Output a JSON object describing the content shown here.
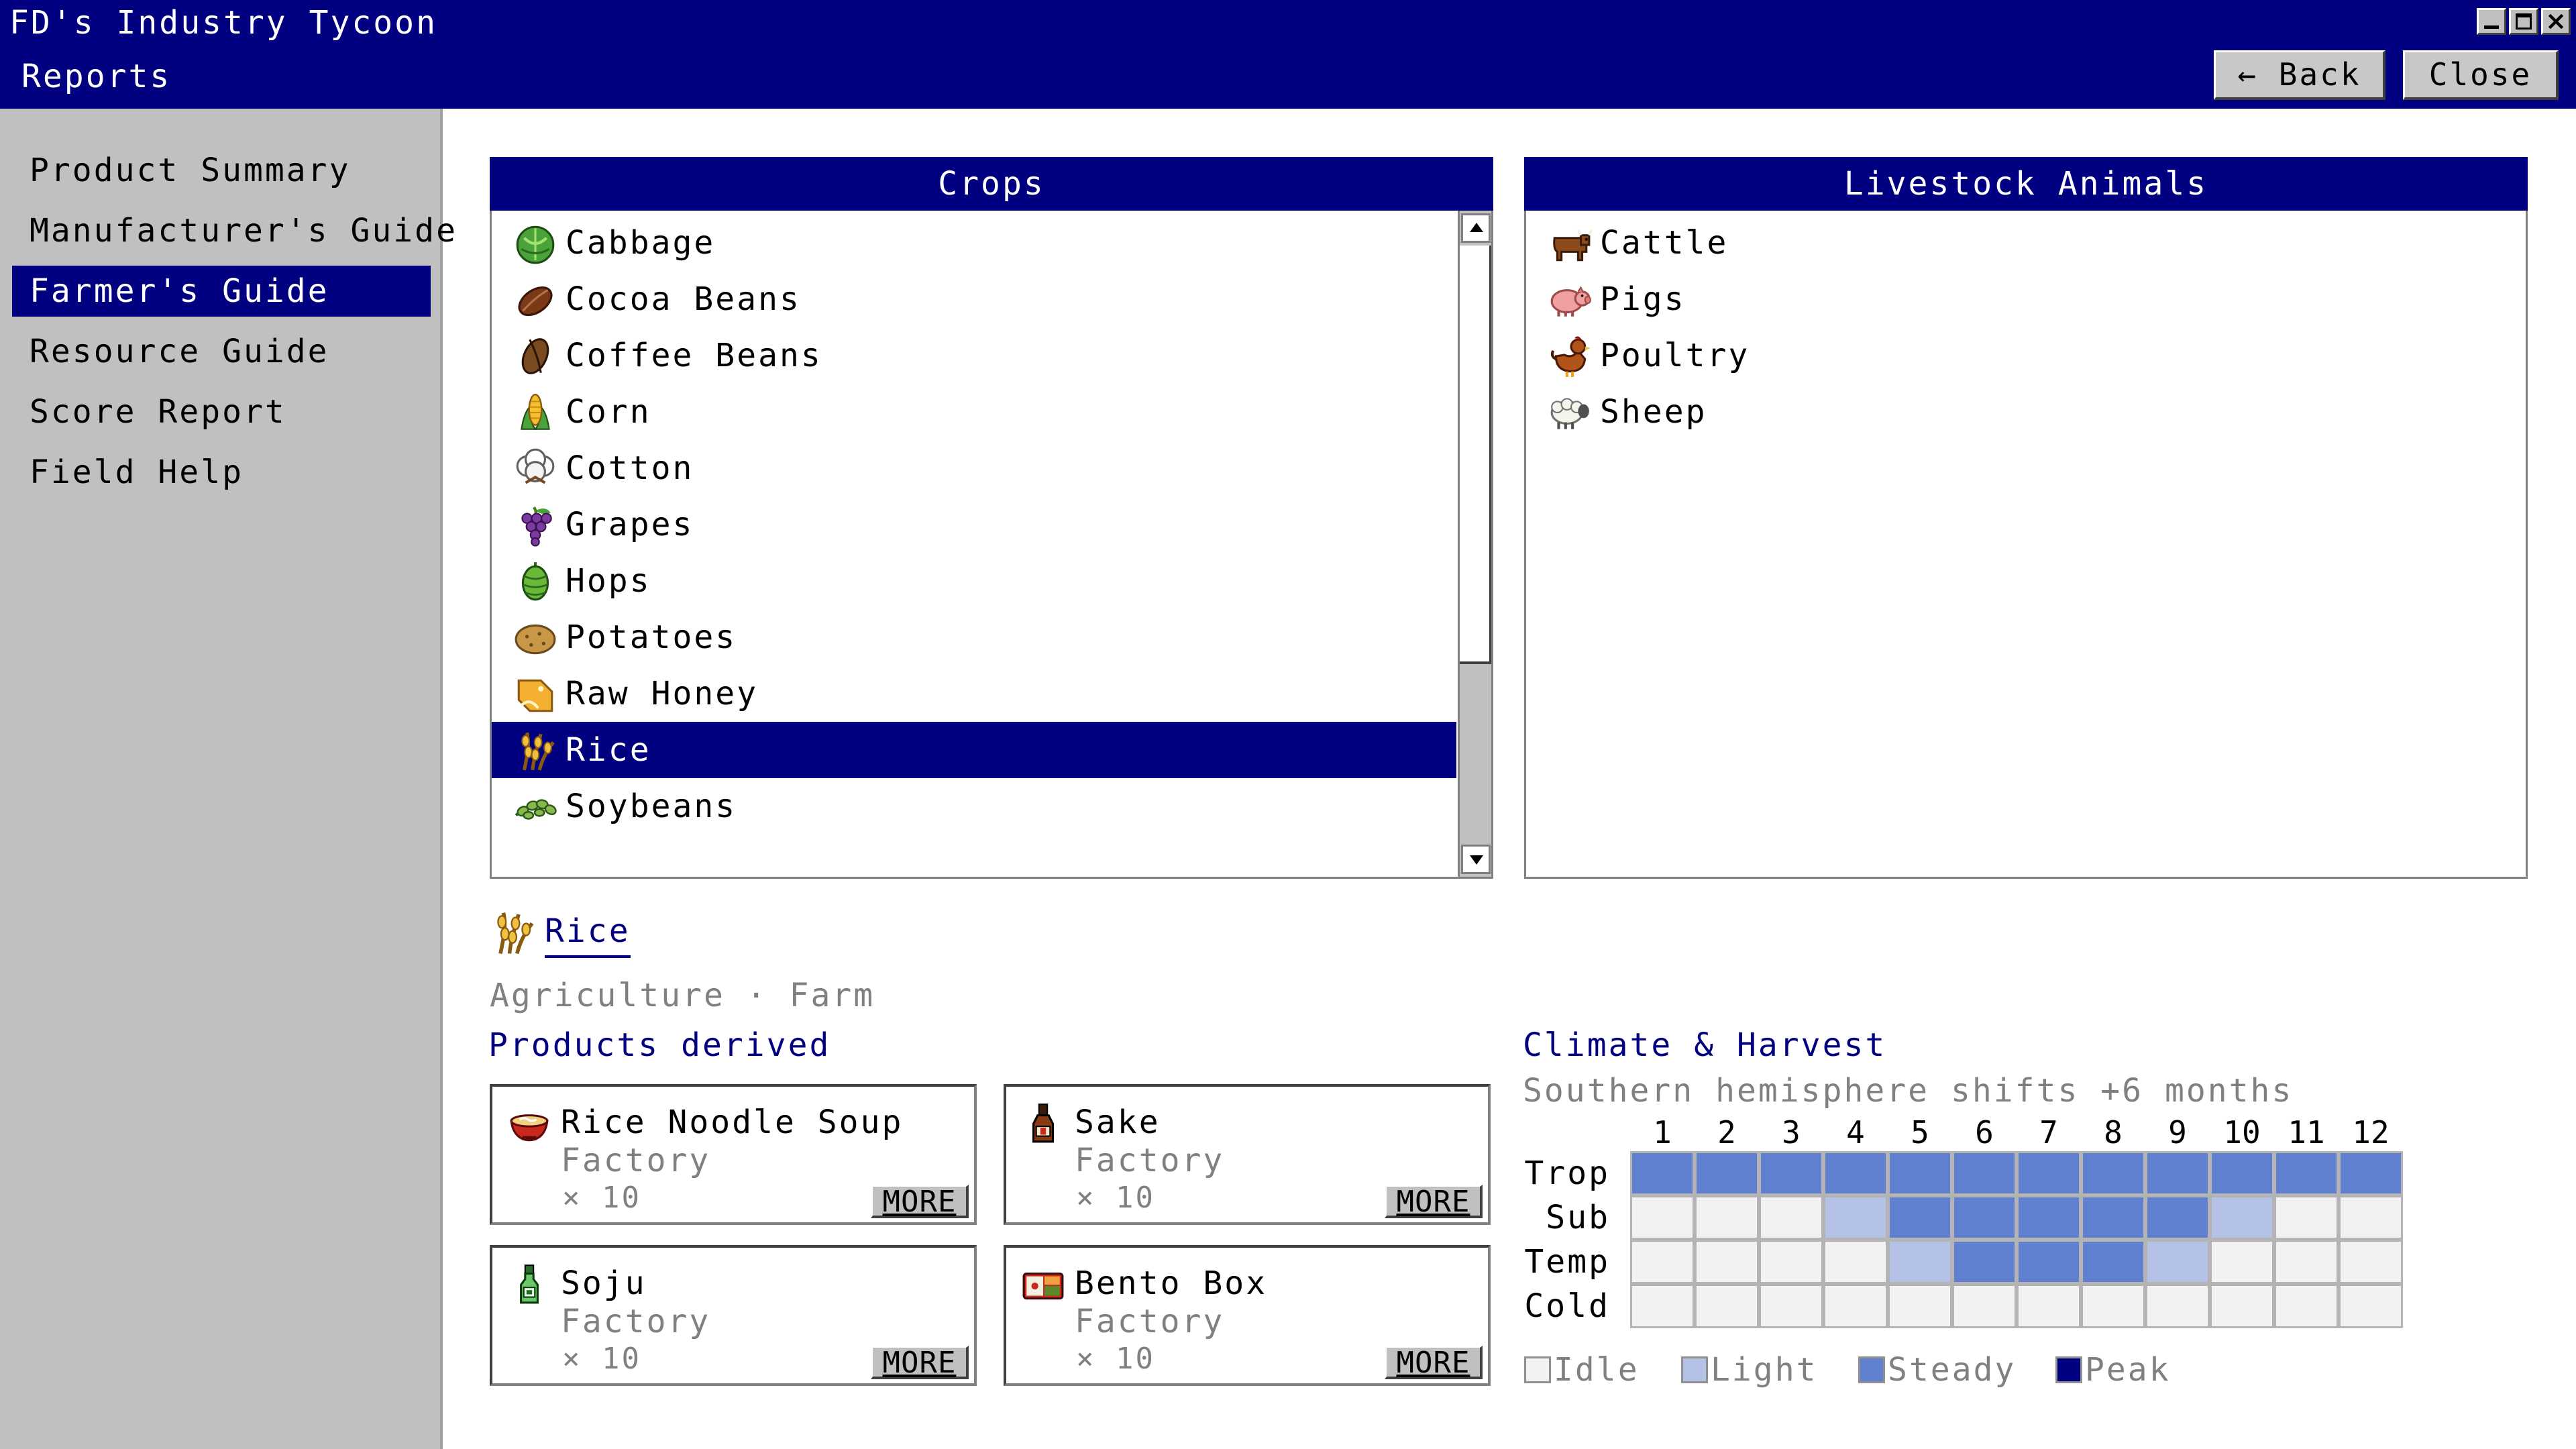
{
  "window": {
    "title": "FD's Industry Tycoon",
    "subtitle": "Reports",
    "back_label": "← Back",
    "close_label": "Close"
  },
  "sidebar": {
    "items": [
      {
        "label": "Product Summary",
        "active": false
      },
      {
        "label": "Manufacturer's Guide",
        "active": false
      },
      {
        "label": "Farmer's Guide",
        "active": true
      },
      {
        "label": "Resource Guide",
        "active": false
      },
      {
        "label": "Score Report",
        "active": false
      },
      {
        "label": "Field Help",
        "active": false
      }
    ]
  },
  "crops": {
    "title": "Crops",
    "selected": "Rice",
    "items": [
      {
        "label": "Cabbage",
        "icon": "cabbage-icon"
      },
      {
        "label": "Cocoa Beans",
        "icon": "cocoa-beans-icon"
      },
      {
        "label": "Coffee Beans",
        "icon": "coffee-beans-icon"
      },
      {
        "label": "Corn",
        "icon": "corn-icon"
      },
      {
        "label": "Cotton",
        "icon": "cotton-icon"
      },
      {
        "label": "Grapes",
        "icon": "grapes-icon"
      },
      {
        "label": "Hops",
        "icon": "hops-icon"
      },
      {
        "label": "Potatoes",
        "icon": "potatoes-icon"
      },
      {
        "label": "Raw Honey",
        "icon": "raw-honey-icon"
      },
      {
        "label": "Rice",
        "icon": "rice-icon"
      },
      {
        "label": "Soybeans",
        "icon": "soybeans-icon"
      }
    ]
  },
  "livestock": {
    "title": "Livestock Animals",
    "items": [
      {
        "label": "Cattle",
        "icon": "cattle-icon"
      },
      {
        "label": "Pigs",
        "icon": "pig-icon"
      },
      {
        "label": "Poultry",
        "icon": "poultry-icon"
      },
      {
        "label": "Sheep",
        "icon": "sheep-icon"
      }
    ]
  },
  "detail": {
    "name": "Rice",
    "icon": "rice-icon",
    "subtitle": "Agriculture · Farm",
    "products_title": "Products derived",
    "products": [
      {
        "name": "Rice Noodle Soup",
        "type": "Factory",
        "qty": "× 10",
        "more_label": "MORE",
        "icon": "noodle-soup-icon"
      },
      {
        "name": "Sake",
        "type": "Factory",
        "qty": "× 10",
        "more_label": "MORE",
        "icon": "sake-bottle-icon"
      },
      {
        "name": "Soju",
        "type": "Factory",
        "qty": "× 10",
        "more_label": "MORE",
        "icon": "soju-bottle-icon"
      },
      {
        "name": "Bento Box",
        "type": "Factory",
        "qty": "× 10",
        "more_label": "MORE",
        "icon": "bento-box-icon"
      }
    ]
  },
  "climate": {
    "title": "Climate & Harvest",
    "subtitle": "Southern hemisphere shifts +6 months",
    "months": [
      "1",
      "2",
      "3",
      "4",
      "5",
      "6",
      "7",
      "8",
      "9",
      "10",
      "11",
      "12"
    ],
    "zones": [
      {
        "label": "Trop",
        "levels": [
          2,
          2,
          2,
          2,
          2,
          2,
          2,
          2,
          2,
          2,
          2,
          2
        ]
      },
      {
        "label": "Sub",
        "levels": [
          0,
          0,
          0,
          1,
          2,
          2,
          2,
          2,
          2,
          1,
          0,
          0
        ]
      },
      {
        "label": "Temp",
        "levels": [
          0,
          0,
          0,
          0,
          1,
          2,
          2,
          2,
          1,
          0,
          0,
          0
        ]
      },
      {
        "label": "Cold",
        "levels": [
          0,
          0,
          0,
          0,
          0,
          0,
          0,
          0,
          0,
          0,
          0,
          0
        ]
      }
    ],
    "legend": [
      {
        "label": "Idle",
        "color": "#f2f2f2"
      },
      {
        "label": "Light",
        "color": "#b4c2e8"
      },
      {
        "label": "Steady",
        "color": "#6080d0"
      },
      {
        "label": "Peak",
        "color": "#000080"
      }
    ]
  },
  "colors": {
    "titlebar": "#000080",
    "selection": "#000080",
    "sidebar": "#c0c0c0"
  }
}
